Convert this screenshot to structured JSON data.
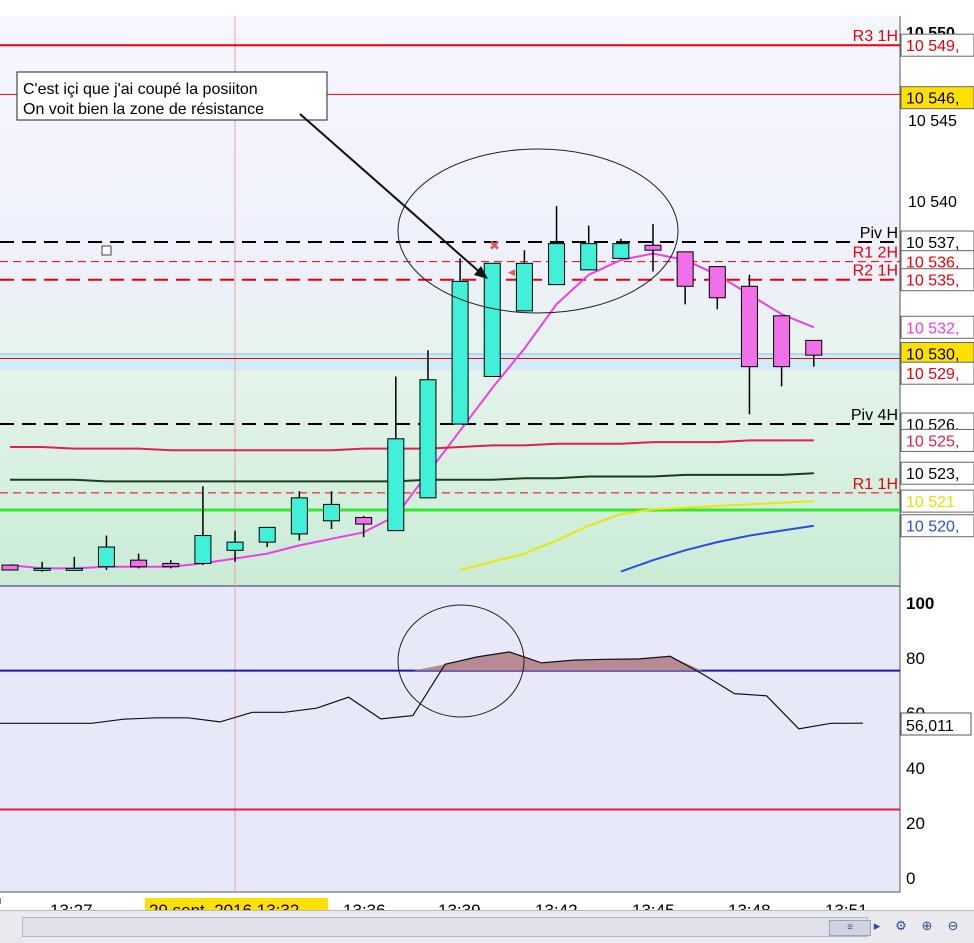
{
  "chart_data": [
    {
      "type": "candlestick",
      "x_tick_labels": [
        "13:27",
        "13:36",
        "13:39",
        "13:42",
        "13:45",
        "13:48",
        "13:51"
      ],
      "cursor_date_label": "29 sept. 2016 13:32",
      "y_tick_labels": [
        "10 550",
        "10 545",
        "10 540"
      ],
      "candles": [
        {
          "o": 10517.8,
          "h": 10517.8,
          "l": 10517.5,
          "c": 10517.5,
          "color": "pink"
        },
        {
          "o": 10517.5,
          "h": 10518.0,
          "l": 10517.4,
          "c": 10517.6,
          "color": "cyan"
        },
        {
          "o": 10517.6,
          "h": 10518.3,
          "l": 10517.5,
          "c": 10517.6,
          "color": "cyan"
        },
        {
          "o": 10517.7,
          "h": 10519.6,
          "l": 10517.5,
          "c": 10518.9,
          "color": "cyan"
        },
        {
          "o": 10518.1,
          "h": 10518.5,
          "l": 10517.6,
          "c": 10517.7,
          "color": "pink"
        },
        {
          "o": 10517.9,
          "h": 10518.1,
          "l": 10517.6,
          "c": 10517.7,
          "color": "pink"
        },
        {
          "o": 10517.9,
          "h": 10522.6,
          "l": 10517.8,
          "c": 10519.6,
          "color": "cyan"
        },
        {
          "o": 10518.7,
          "h": 10519.9,
          "l": 10518.0,
          "c": 10519.2,
          "color": "cyan"
        },
        {
          "o": 10519.2,
          "h": 10520.1,
          "l": 10518.9,
          "c": 10520.1,
          "color": "cyan"
        },
        {
          "o": 10519.7,
          "h": 10522.3,
          "l": 10519.3,
          "c": 10521.9,
          "color": "cyan"
        },
        {
          "o": 10520.5,
          "h": 10522.3,
          "l": 10520.0,
          "c": 10521.5,
          "color": "cyan"
        },
        {
          "o": 10520.7,
          "h": 10520.8,
          "l": 10519.5,
          "c": 10520.3,
          "color": "pink"
        },
        {
          "o": 10519.9,
          "h": 10529.3,
          "l": 10519.9,
          "c": 10525.5,
          "color": "cyan"
        },
        {
          "o": 10521.9,
          "h": 10530.9,
          "l": 10521.9,
          "c": 10529.1,
          "color": "cyan"
        },
        {
          "o": 10526.4,
          "h": 10536.5,
          "l": 10526.4,
          "c": 10535.1,
          "color": "cyan"
        },
        {
          "o": 10529.3,
          "h": 10536.2,
          "l": 10529.3,
          "c": 10536.2,
          "color": "cyan"
        },
        {
          "o": 10533.3,
          "h": 10537.0,
          "l": 10533.3,
          "c": 10536.2,
          "color": "cyan"
        },
        {
          "o": 10534.9,
          "h": 10539.7,
          "l": 10534.9,
          "c": 10537.4,
          "color": "cyan"
        },
        {
          "o": 10535.8,
          "h": 10538.5,
          "l": 10535.8,
          "c": 10537.4,
          "color": "cyan"
        },
        {
          "o": 10536.5,
          "h": 10537.7,
          "l": 10536.5,
          "c": 10537.4,
          "color": "cyan"
        },
        {
          "o": 10537.0,
          "h": 10538.6,
          "l": 10535.7,
          "c": 10537.3,
          "color": "pink"
        },
        {
          "o": 10536.9,
          "h": 10536.9,
          "l": 10533.7,
          "c": 10534.8,
          "color": "pink"
        },
        {
          "o": 10536.0,
          "h": 10536.0,
          "l": 10533.4,
          "c": 10534.1,
          "color": "pink"
        },
        {
          "o": 10534.8,
          "h": 10535.5,
          "l": 10527.0,
          "c": 10529.9,
          "color": "pink"
        },
        {
          "o": 10533.0,
          "h": 10533.0,
          "l": 10528.7,
          "c": 10529.9,
          "color": "pink"
        },
        {
          "o": 10531.5,
          "h": 10531.5,
          "l": 10529.9,
          "c": 10530.6,
          "color": "pink"
        }
      ],
      "levels": [
        {
          "name": "R3 1H",
          "value": 10549.5,
          "color": "#e8000b",
          "style": "solid",
          "axis_label": "10 549,"
        },
        {
          "name": "",
          "value": 10546.5,
          "color": "#e8000b",
          "style": "thin",
          "axis_label": "10 546,"
        },
        {
          "name": "Piv H",
          "value": 10537.5,
          "color": "#000000",
          "style": "dashed",
          "axis_label": "10 537,"
        },
        {
          "name": "R1 2H",
          "value": 10536.3,
          "color": "#e8000b",
          "style": "dashed-thin",
          "axis_label": "10 536,"
        },
        {
          "name": "R2 1H",
          "value": 10535.2,
          "color": "#e8000b",
          "style": "dashed",
          "axis_label": "10 535,"
        },
        {
          "name": "",
          "value": 10530.4,
          "color": "#e8000b",
          "style": "thin",
          "axis_label": "10 530,"
        },
        {
          "name": "Piv 4H",
          "value": 10526.4,
          "color": "#000000",
          "style": "dashed",
          "axis_label": "10 526,"
        },
        {
          "name": "R1 1H",
          "value": 10522.2,
          "color": "#e8000b",
          "style": "dashed-thin",
          "axis_label": ""
        }
      ],
      "axis_price_labels": [
        {
          "text": "10 549,",
          "value": 10549.5,
          "bg": "#ffffff",
          "color": "#e8000b"
        },
        {
          "text": "10 546,",
          "value": 10546.3,
          "bg": "#ffe000",
          "color": "#000000"
        },
        {
          "text": "10 537,",
          "value": 10537.5,
          "bg": "#ffffff",
          "color": "#000000"
        },
        {
          "text": "10 536,",
          "value": 10536.3,
          "bg": "#ffffff",
          "color": "#e8000b"
        },
        {
          "text": "10 535,",
          "value": 10535.2,
          "bg": "#ffffff",
          "color": "#e8000b"
        },
        {
          "text": "10 532,",
          "value": 10532.3,
          "bg": "#ffffff",
          "color": "#ee3ee8"
        },
        {
          "text": "10 530,",
          "value": 10530.7,
          "bg": "#ffe000",
          "color": "#000000"
        },
        {
          "text": "10 529,",
          "value": 10529.5,
          "bg": "#ffffff",
          "color": "#e8000b"
        },
        {
          "text": "10 526,",
          "value": 10526.4,
          "bg": "#ffffff",
          "color": "#000000"
        },
        {
          "text": "10 525,",
          "value": 10525.4,
          "bg": "#ffffff",
          "color": "#e0204f"
        },
        {
          "text": "10 523,",
          "value": 10523.4,
          "bg": "#ffffff",
          "color": "#000000"
        },
        {
          "text": "10 521",
          "value": 10521.7,
          "bg": "#ffffff",
          "color": "#e8e000"
        },
        {
          "text": "10 520,",
          "value": 10520.2,
          "bg": "#ffffff",
          "color": "#2c4fd6"
        }
      ],
      "moving_averages": [
        {
          "color": "#ee3ee8",
          "values": [
            10517.8,
            10517.6,
            10517.6,
            10517.7,
            10517.7,
            10517.7,
            10517.9,
            10518.2,
            10518.5,
            10519.0,
            10519.4,
            10519.8,
            10520.8,
            10523.4,
            10526.0,
            10528.6,
            10531.0,
            10533.7,
            10535.5,
            10536.4,
            10536.8,
            10536.4,
            10535.5,
            10534.3,
            10533.1,
            10532.3
          ]
        },
        {
          "color": "#e0204f",
          "values": [
            10525.0,
            10525.0,
            10524.9,
            10524.9,
            10524.9,
            10524.8,
            10524.8,
            10524.8,
            10524.8,
            10524.8,
            10524.8,
            10524.9,
            10524.9,
            10524.9,
            10525.0,
            10525.1,
            10525.1,
            10525.2,
            10525.2,
            10525.2,
            10525.3,
            10525.3,
            10525.3,
            10525.4,
            10525.4,
            10525.4
          ]
        },
        {
          "color": "#1a3d1a",
          "values": [
            10523.0,
            10523.0,
            10523.0,
            10522.9,
            10522.9,
            10522.9,
            10522.9,
            10522.9,
            10522.9,
            10522.9,
            10522.9,
            10522.9,
            10522.9,
            10523.0,
            10523.0,
            10523.0,
            10523.1,
            10523.1,
            10523.2,
            10523.2,
            10523.2,
            10523.3,
            10523.3,
            10523.3,
            10523.3,
            10523.4
          ]
        },
        {
          "color": "#e8e800",
          "values": [
            null,
            null,
            null,
            null,
            null,
            null,
            null,
            null,
            null,
            null,
            null,
            null,
            null,
            null,
            10517.5,
            10518.0,
            10518.5,
            10519.3,
            10520.2,
            10520.9,
            10521.2,
            10521.3,
            10521.4,
            10521.5,
            10521.6,
            10521.7
          ]
        },
        {
          "color": "#2c4fd6",
          "values": [
            null,
            null,
            null,
            null,
            null,
            null,
            null,
            null,
            null,
            null,
            null,
            null,
            null,
            null,
            null,
            null,
            null,
            null,
            null,
            10517.4,
            10518.1,
            10518.7,
            10519.2,
            10519.6,
            10519.9,
            10520.2
          ]
        }
      ],
      "annotation": [
        "C'est içi que j'ai coupé la posiiton",
        "On voit bien la zone de résistance"
      ]
    },
    {
      "type": "line",
      "name": "oscillator",
      "y_tick_labels": [
        "100",
        "80",
        "60",
        "40",
        "20",
        "0"
      ],
      "ylim": [
        0,
        100
      ],
      "levels": [
        {
          "value": 75.2,
          "color": "#1a1a9e"
        },
        {
          "value": 24.6,
          "color": "#e0204f"
        }
      ],
      "values": [
        56.0,
        56.0,
        56.0,
        56.0,
        57.5,
        58.0,
        58.0,
        56.5,
        60.0,
        60.0,
        61.5,
        65.5,
        57.6,
        58.8,
        77.5,
        80.2,
        82.0,
        78.0,
        79.0,
        79.3,
        79.4,
        80.4,
        74.0,
        66.8,
        66.0,
        54.0,
        56.0,
        56.011
      ],
      "last_value_label": "56,011"
    }
  ]
}
